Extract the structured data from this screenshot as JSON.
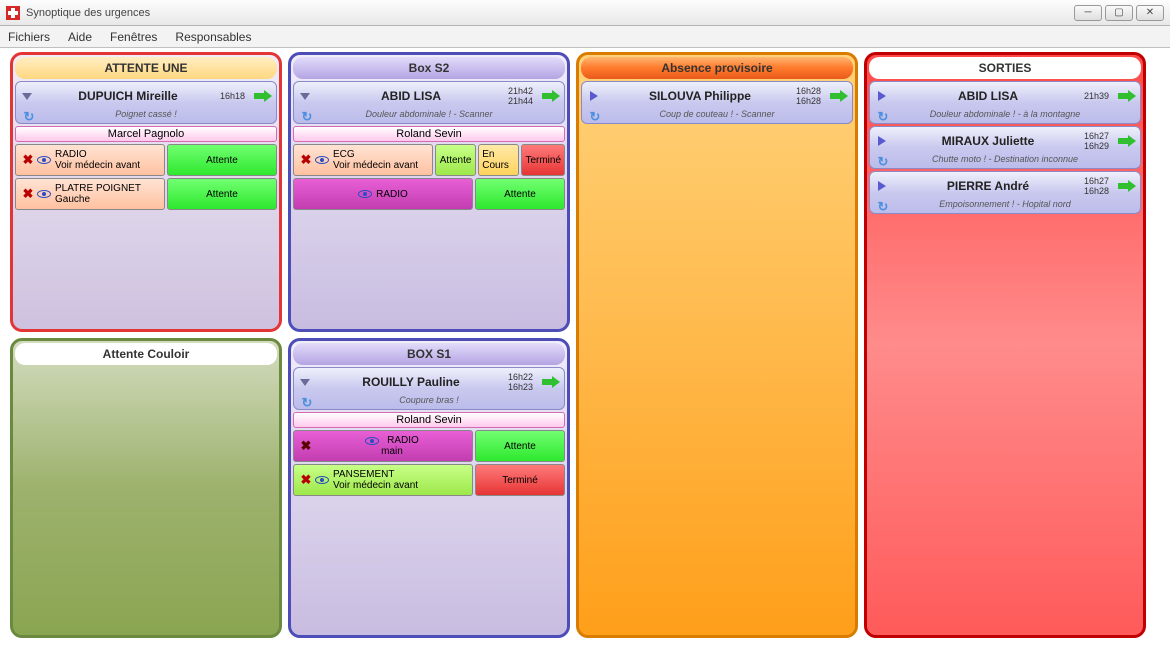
{
  "window": {
    "title": "Synoptique des urgences"
  },
  "menu": {
    "fichiers": "Fichiers",
    "aide": "Aide",
    "fenetres": "Fenêtres",
    "responsables": "Responsables"
  },
  "zones": {
    "attente": {
      "title": "ATTENTE UNE"
    },
    "couloir": {
      "title": "Attente Couloir"
    },
    "box2": {
      "title": "Box S2"
    },
    "box1": {
      "title": "BOX S1"
    },
    "absence": {
      "title": "Absence provisoire"
    },
    "sorties": {
      "title": "SORTIES"
    }
  },
  "patients": {
    "dupuich": {
      "name": "DUPUICH Mireille",
      "time1": "16h18",
      "sub": "Poignet cassé !",
      "nurse": "Marcel Pagnolo",
      "task1_line1": "RADIO",
      "task1_line2": "Voir médecin avant",
      "task1_status": "Attente",
      "task2_line1": "PLATRE POIGNET",
      "task2_line2": "Gauche",
      "task2_status": "Attente"
    },
    "abid_box2": {
      "name": "ABID LISA",
      "time1": "21h42",
      "time2": "21h44",
      "sub": "Douleur abdominale ! - Scanner",
      "nurse": "Roland Sevin",
      "task1_line1": "ECG",
      "task1_line2": "Voir médecin avant",
      "task1_s1": "Attente",
      "task1_s2": "En Cours",
      "task1_s3": "Terminé",
      "task2_line1": "RADIO",
      "task2_status": "Attente"
    },
    "rouilly": {
      "name": "ROUILLY Pauline",
      "time1": "16h22",
      "time2": "16h23",
      "sub": "Coupure bras !",
      "nurse": "Roland Sevin",
      "task1_line1": "RADIO",
      "task1_line2": "main",
      "task1_status": "Attente",
      "task2_line1": "PANSEMENT",
      "task2_line2": "Voir médecin avant",
      "task2_status": "Terminé"
    },
    "silouva": {
      "name": "SILOUVA Philippe",
      "time1": "16h28",
      "time2": "16h28",
      "sub": "Coup de couteau ! - Scanner"
    },
    "abid_sortie": {
      "name": "ABID LISA",
      "time1": "21h39",
      "sub": "Douleur abdominale ! - à la montagne"
    },
    "miraux": {
      "name": "MIRAUX Juliette",
      "time1": "16h27",
      "time2": "16h29",
      "sub": "Chutte moto ! - Destination inconnue"
    },
    "pierre": {
      "name": "PIERRE André",
      "time1": "16h27",
      "time2": "16h28",
      "sub": "Empoisonnement ! - Hopital nord"
    }
  }
}
